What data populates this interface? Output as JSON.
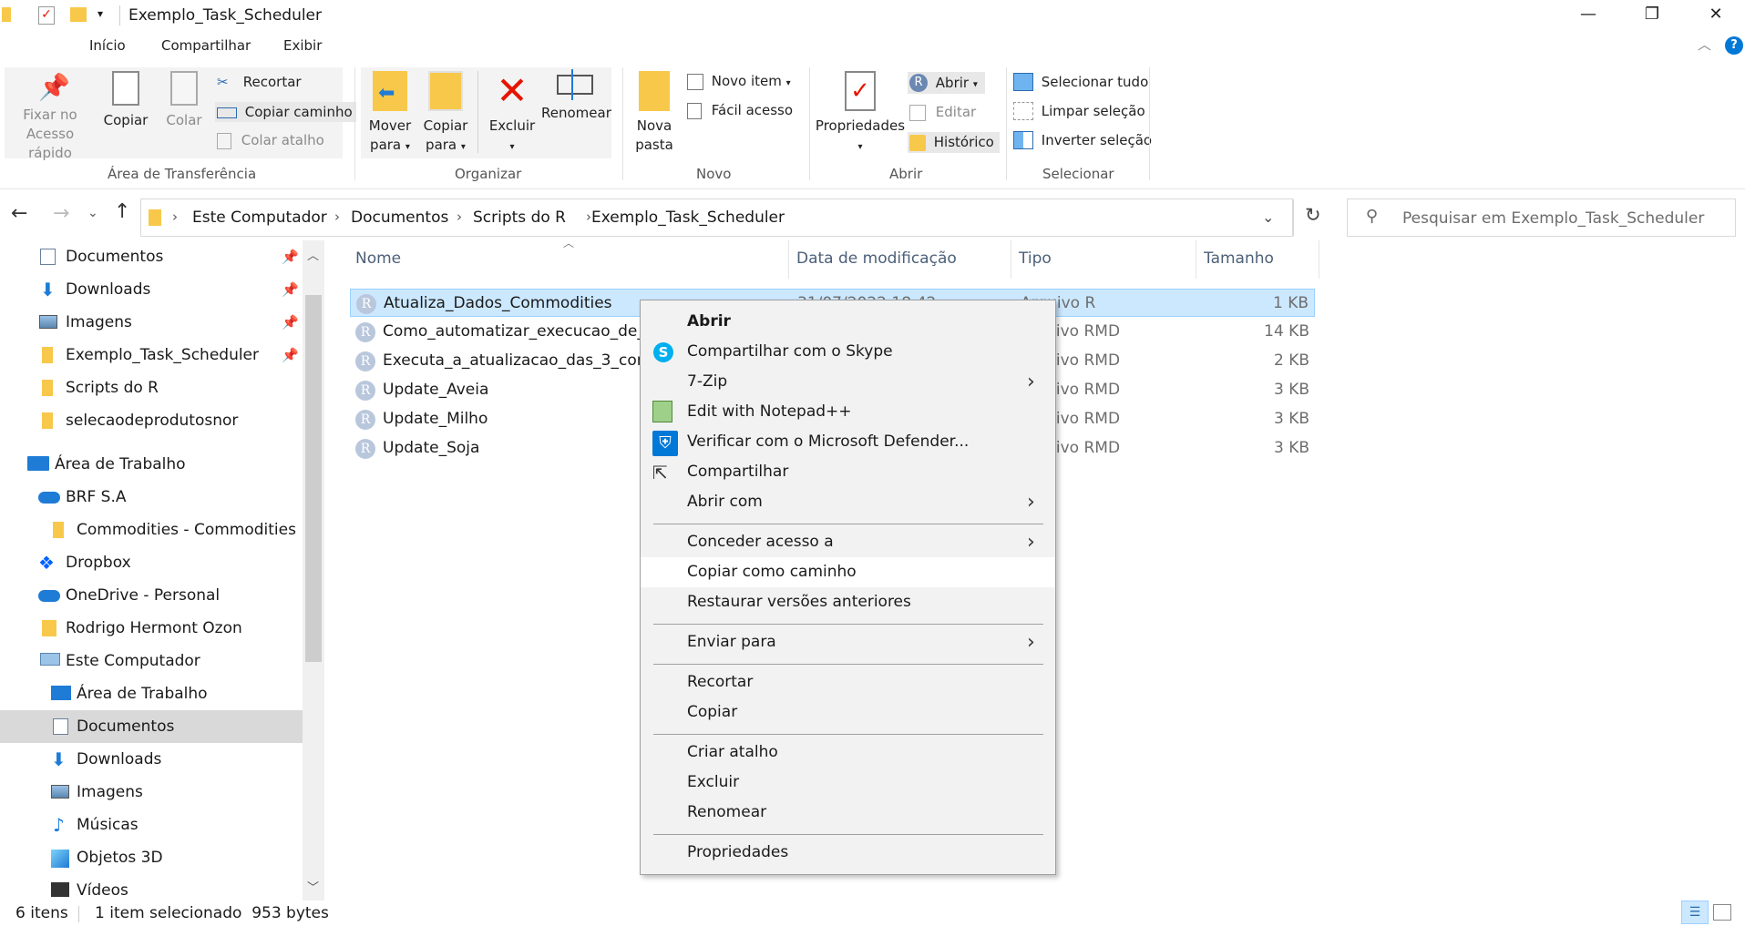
{
  "window": {
    "title": "Exemplo_Task_Scheduler",
    "minimize": "—",
    "maximize": "❐",
    "close": "✕"
  },
  "ribbon_tabs": [
    "Início",
    "Compartilhar",
    "Exibir"
  ],
  "ribbon": {
    "clipboard": {
      "pin_label_1": "Fixar no",
      "pin_label_2": "Acesso rápido",
      "copy": "Copiar",
      "paste": "Colar",
      "cut": "Recortar",
      "copy_path": "Copiar caminho",
      "paste_shortcut": "Colar atalho",
      "group": "Área de Transferência"
    },
    "organize": {
      "move_1": "Mover",
      "move_2": "para",
      "copy_1": "Copiar",
      "copy_2": "para",
      "delete": "Excluir",
      "rename": "Renomear",
      "group": "Organizar"
    },
    "new": {
      "new_folder_1": "Nova",
      "new_folder_2": "pasta",
      "new_item": "Novo item",
      "easy_access": "Fácil acesso",
      "group": "Novo"
    },
    "open": {
      "properties": "Propriedades",
      "open": "Abrir",
      "edit": "Editar",
      "history": "Histórico",
      "group": "Abrir"
    },
    "select": {
      "select_all": "Selecionar tudo",
      "clear": "Limpar seleção",
      "invert": "Inverter seleção",
      "group": "Selecionar"
    }
  },
  "address": {
    "breadcrumbs": [
      "Este Computador",
      "Documentos",
      "Scripts do R",
      "Exemplo_Task_Scheduler"
    ],
    "search_placeholder": "Pesquisar em Exemplo_Task_Scheduler"
  },
  "nav_pane": [
    {
      "label": "Documentos",
      "pinned": true
    },
    {
      "label": "Downloads",
      "pinned": true
    },
    {
      "label": "Imagens",
      "pinned": true
    },
    {
      "label": "Exemplo_Task_Scheduler",
      "pinned": true
    },
    {
      "label": "Scripts do R"
    },
    {
      "label": "selecaodeprodutosnor"
    },
    {
      "label": "Área de Trabalho"
    },
    {
      "label": "BRF S.A"
    },
    {
      "label": "Commodities - Commodities"
    },
    {
      "label": "Dropbox"
    },
    {
      "label": "OneDrive - Personal"
    },
    {
      "label": "Rodrigo Hermont Ozon"
    },
    {
      "label": "Este Computador"
    },
    {
      "label": "Área de Trabalho"
    },
    {
      "label": "Documentos",
      "selected": true
    },
    {
      "label": "Downloads"
    },
    {
      "label": "Imagens"
    },
    {
      "label": "Músicas"
    },
    {
      "label": "Objetos 3D"
    },
    {
      "label": "Vídeos"
    }
  ],
  "columns": {
    "name": "Nome",
    "date": "Data de modificação",
    "type": "Tipo",
    "size": "Tamanho"
  },
  "files": [
    {
      "name": "Atualiza_Dados_Commodities",
      "date": "31/07/2022 18:42",
      "type": "Arquivo R",
      "size": "1 KB"
    },
    {
      "name": "Como_automatizar_execucao_de_Rmd",
      "date": "",
      "type": "Arquivo RMD",
      "size": "14 KB"
    },
    {
      "name": "Executa_a_atualizacao_das_3_commodities",
      "date": "",
      "type": "Arquivo RMD",
      "size": "2 KB"
    },
    {
      "name": "Update_Aveia",
      "date": "",
      "type": "Arquivo RMD",
      "size": "3 KB"
    },
    {
      "name": "Update_Milho",
      "date": "",
      "type": "Arquivo RMD",
      "size": "3 KB"
    },
    {
      "name": "Update_Soja",
      "date": "",
      "type": "Arquivo RMD",
      "size": "3 KB"
    }
  ],
  "context_menu": {
    "open": "Abrir",
    "skype": "Compartilhar com o Skype",
    "zip": "7-Zip",
    "notepad": "Edit with Notepad++",
    "defender": "Verificar com o Microsoft Defender...",
    "share": "Compartilhar",
    "open_with": "Abrir com",
    "grant_access": "Conceder acesso a",
    "copy_path": "Copiar como caminho",
    "restore": "Restaurar versões anteriores",
    "send_to": "Enviar para",
    "cut": "Recortar",
    "copy": "Copiar",
    "shortcut": "Criar atalho",
    "delete": "Excluir",
    "rename": "Renomear",
    "properties": "Propriedades"
  },
  "status": {
    "count": "6 itens",
    "selection": "1 item selecionado  953 bytes"
  },
  "colors": {
    "selection_bg": "#cce8ff",
    "selection_border": "#99d1ff",
    "folder_yellow": "#f8c84b",
    "delete_red": "#e51400",
    "accent_blue": "#0078d7"
  }
}
